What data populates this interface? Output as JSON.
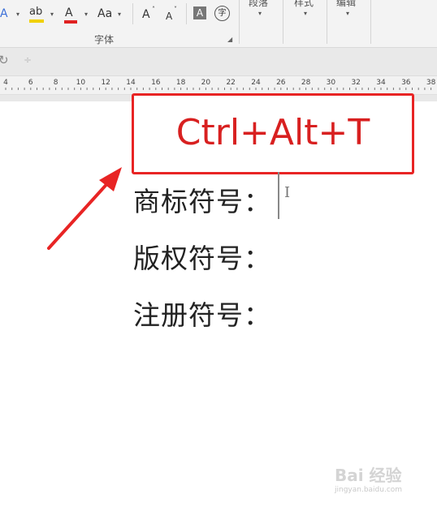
{
  "ribbon": {
    "font_group": {
      "label": "字体",
      "buttons": [
        "A",
        "ab",
        "A",
        "Aa",
        "A",
        "A",
        "A",
        "字"
      ]
    },
    "paragraph_label": "段落",
    "styles_label": "样式",
    "editing_label": "编辑"
  },
  "quick_access": {
    "undo_glyph": "↻",
    "more_glyph": "÷"
  },
  "ruler": {
    "numbers": [
      "4",
      "6",
      "8",
      "10",
      "12",
      "14",
      "16",
      "18",
      "20",
      "22",
      "24",
      "26",
      "28",
      "30",
      "32",
      "34",
      "36",
      "38"
    ]
  },
  "document": {
    "shortcut": "Ctrl+Alt+T",
    "lines": [
      "商标符号：",
      "版权符号：",
      "注册符号："
    ]
  },
  "watermark": {
    "text": "Bai 经验",
    "sub": "jingyan.baidu.com"
  },
  "colors": {
    "highlight": "#f0d000",
    "font_color": "#e02020",
    "annotation_red": "#e82424"
  }
}
